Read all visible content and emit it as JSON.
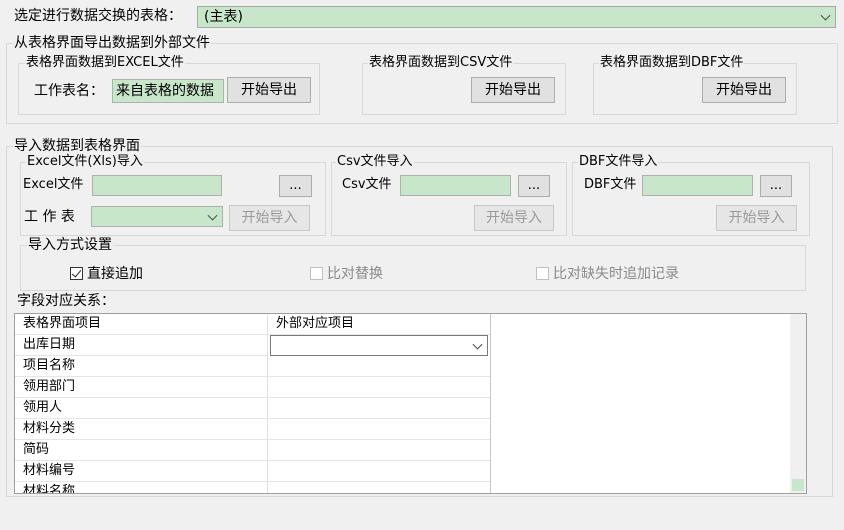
{
  "top": {
    "label": "选定进行数据交换的表格：",
    "selected": "(主表)"
  },
  "export": {
    "title": "从表格界面导出数据到外部文件",
    "excel": {
      "title": "表格界面数据到EXCEL文件",
      "sheet_label": "工作表名：",
      "sheet_value": "来自表格的数据",
      "button": "开始导出"
    },
    "csv": {
      "title": "表格界面数据到CSV文件",
      "button": "开始导出"
    },
    "dbf": {
      "title": "表格界面数据到DBF文件",
      "button": "开始导出"
    }
  },
  "import": {
    "title": "导入数据到表格界面",
    "excel": {
      "title": "Excel文件(Xls)导入",
      "file_label": "Excel文件",
      "browse": "...",
      "sheet_label": "工 作 表",
      "button": "开始导入"
    },
    "csv": {
      "title": "Csv文件导入",
      "file_label": "Csv文件",
      "browse": "...",
      "button": "开始导入"
    },
    "dbf": {
      "title": "DBF文件导入",
      "file_label": "DBF文件",
      "browse": "...",
      "button": "开始导入"
    },
    "mode": {
      "title": "导入方式设置",
      "options": [
        {
          "label": "直接追加",
          "checked": true,
          "enabled": true
        },
        {
          "label": "比对替换",
          "checked": false,
          "enabled": false
        },
        {
          "label": "比对缺失时追加记录",
          "checked": false,
          "enabled": false
        }
      ]
    }
  },
  "mapping": {
    "label": "字段对应关系：",
    "headers": [
      "表格界面项目",
      "外部对应项目"
    ],
    "rows": [
      "出库日期",
      "项目名称",
      "领用部门",
      "领用人",
      "材料分类",
      "简码",
      "材料编号",
      "材料名称"
    ]
  }
}
